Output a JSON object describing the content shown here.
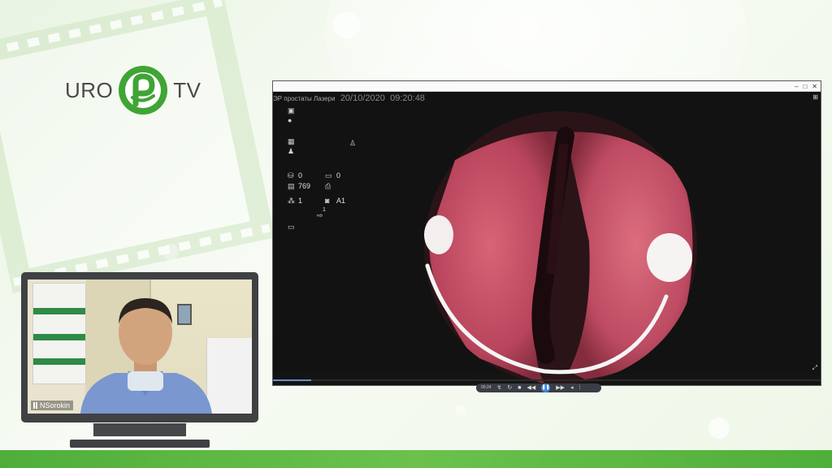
{
  "logo": {
    "left_text": "URO",
    "right_text": "TV",
    "brand_color": "#3fa535"
  },
  "presenter": {
    "name": "NSorokin"
  },
  "app": {
    "title": "ЭР простаты Лазери",
    "date": "20/10/2020",
    "time": "09:20:48",
    "side_panel": {
      "counter_a": "0",
      "counter_b": "0",
      "counter_c": "769",
      "counter_d": "1",
      "counter_e": "A1",
      "sup_value": "1"
    },
    "playback": {
      "time": "00:24",
      "progress_percent": 7
    }
  },
  "colors": {
    "accent": "#3f87d8",
    "green_bar": "#5cb846"
  }
}
